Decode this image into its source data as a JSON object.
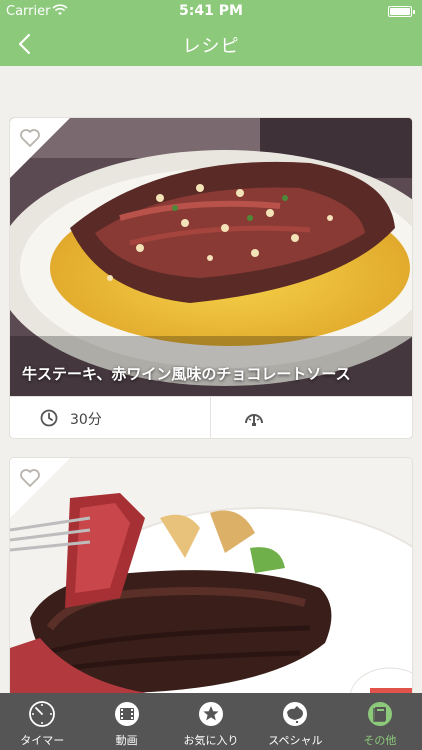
{
  "status": {
    "carrier": "Carrier",
    "time": "5:41 PM"
  },
  "nav": {
    "title": "レシピ"
  },
  "recipes": [
    {
      "title": "牛ステーキ、赤ワイン風味のチョコレートソース",
      "time": "30分"
    },
    {
      "title": "",
      "time": ""
    }
  ],
  "tabs": [
    {
      "label": "タイマー",
      "icon": "timer-icon"
    },
    {
      "label": "動画",
      "icon": "video-icon"
    },
    {
      "label": "お気に入り",
      "icon": "star-icon"
    },
    {
      "label": "スペシャル",
      "icon": "australia-icon"
    },
    {
      "label": "その他",
      "icon": "book-icon"
    }
  ],
  "colors": {
    "accent": "#8cc97a",
    "tabbar": "#555555",
    "background": "#f2f0ec"
  }
}
